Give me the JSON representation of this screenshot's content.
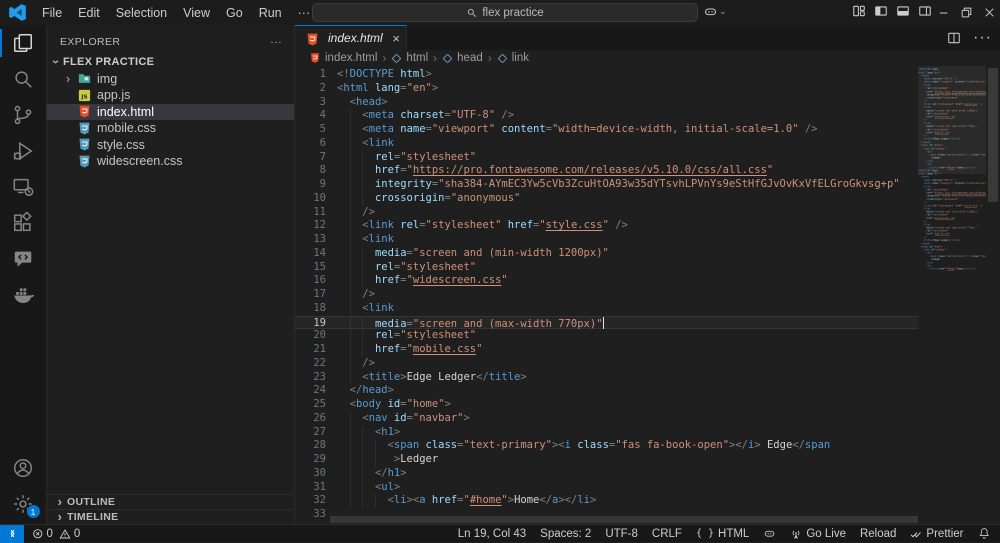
{
  "colors": {
    "accent": "#0078d4",
    "html_icon": "#e44d26",
    "css_icon": "#519aba",
    "js_icon": "#cbcb41",
    "folder_icon": "#45a795",
    "logo": "#1f9cf0",
    "symbol_icon": "#75a3c9"
  },
  "titlebar": {
    "menus": [
      "File",
      "Edit",
      "Selection",
      "View",
      "Go",
      "Run"
    ],
    "more_label": "···",
    "search_value": "flex practice"
  },
  "activitybar": {
    "items": [
      {
        "name": "explorer-icon",
        "active": true
      },
      {
        "name": "search-icon",
        "active": false
      },
      {
        "name": "source-control-icon",
        "active": false
      },
      {
        "name": "run-debug-icon",
        "active": false
      },
      {
        "name": "remote-explorer-icon",
        "active": false
      },
      {
        "name": "extensions-icon",
        "active": false
      },
      {
        "name": "chat-icon",
        "active": false
      },
      {
        "name": "docker-icon",
        "active": false
      }
    ],
    "bottom": [
      {
        "name": "account-icon"
      },
      {
        "name": "settings-gear-icon",
        "badge": "1"
      }
    ]
  },
  "sidebar": {
    "header": "EXPLORER",
    "root": "FLEX PRACTICE",
    "files": [
      {
        "label": "img",
        "type": "folder",
        "chevron": true
      },
      {
        "label": "app.js",
        "type": "js"
      },
      {
        "label": "index.html",
        "type": "html",
        "selected": true
      },
      {
        "label": "mobile.css",
        "type": "css"
      },
      {
        "label": "style.css",
        "type": "css"
      },
      {
        "label": "widescreen.css",
        "type": "css"
      }
    ],
    "sections": [
      "OUTLINE",
      "TIMELINE"
    ]
  },
  "editor": {
    "tab": {
      "label": "index.html",
      "close": "×"
    },
    "breadcrumbs": [
      {
        "label": "index.html",
        "icon": "html"
      },
      {
        "label": "html",
        "icon": "symbol"
      },
      {
        "label": "head",
        "icon": "symbol"
      },
      {
        "label": "link",
        "icon": "symbol"
      }
    ],
    "lines": [
      {
        "n": 1,
        "ind": 0,
        "tok": [
          [
            "p",
            "<!"
          ],
          [
            "t",
            "DOCTYPE"
          ],
          [
            "a",
            " html"
          ],
          [
            "p",
            ">"
          ]
        ]
      },
      {
        "n": 2,
        "ind": 0,
        "tok": [
          [
            "p",
            "<"
          ],
          [
            "t",
            "html"
          ],
          [
            "a",
            " lang"
          ],
          [
            "p",
            "="
          ],
          [
            "s",
            "\"en\""
          ],
          [
            "p",
            ">"
          ]
        ]
      },
      {
        "n": 3,
        "ind": 2,
        "tok": [
          [
            "p",
            "<"
          ],
          [
            "t",
            "head"
          ],
          [
            "p",
            ">"
          ]
        ]
      },
      {
        "n": 4,
        "ind": 4,
        "tok": [
          [
            "p",
            "<"
          ],
          [
            "t",
            "meta"
          ],
          [
            "a",
            " charset"
          ],
          [
            "p",
            "="
          ],
          [
            "s",
            "\"UTF-8\""
          ],
          [
            "p",
            " />"
          ]
        ]
      },
      {
        "n": 5,
        "ind": 4,
        "tok": [
          [
            "p",
            "<"
          ],
          [
            "t",
            "meta"
          ],
          [
            "a",
            " name"
          ],
          [
            "p",
            "="
          ],
          [
            "s",
            "\"viewport\""
          ],
          [
            "a",
            " content"
          ],
          [
            "p",
            "="
          ],
          [
            "s",
            "\"width=device-width, initial-scale=1.0\""
          ],
          [
            "p",
            " />"
          ]
        ]
      },
      {
        "n": 6,
        "ind": 4,
        "tok": [
          [
            "p",
            "<"
          ],
          [
            "t",
            "link"
          ]
        ]
      },
      {
        "n": 7,
        "ind": 6,
        "tok": [
          [
            "a",
            "rel"
          ],
          [
            "p",
            "="
          ],
          [
            "s",
            "\"stylesheet\""
          ]
        ]
      },
      {
        "n": 8,
        "ind": 6,
        "tok": [
          [
            "a",
            "href"
          ],
          [
            "p",
            "="
          ],
          [
            "s",
            "\""
          ],
          [
            "u",
            "https://pro.fontawesome.com/releases/v5.10.0/css/all.css"
          ],
          [
            "s",
            "\""
          ]
        ]
      },
      {
        "n": 9,
        "ind": 6,
        "tok": [
          [
            "a",
            "integrity"
          ],
          [
            "p",
            "="
          ],
          [
            "s",
            "\"sha384-AYmEC3Yw5cVb3ZcuHtOA93w35dYTsvhLPVnYs9eStHfGJvOvKxVfELGroGkvsg+p\""
          ]
        ]
      },
      {
        "n": 10,
        "ind": 6,
        "tok": [
          [
            "a",
            "crossorigin"
          ],
          [
            "p",
            "="
          ],
          [
            "s",
            "\"anonymous\""
          ]
        ]
      },
      {
        "n": 11,
        "ind": 4,
        "tok": [
          [
            "p",
            "/>"
          ]
        ]
      },
      {
        "n": 12,
        "ind": 4,
        "tok": [
          [
            "p",
            "<"
          ],
          [
            "t",
            "link"
          ],
          [
            "a",
            " rel"
          ],
          [
            "p",
            "="
          ],
          [
            "s",
            "\"stylesheet\""
          ],
          [
            "a",
            " href"
          ],
          [
            "p",
            "="
          ],
          [
            "s",
            "\""
          ],
          [
            "u",
            "style.css"
          ],
          [
            "s",
            "\""
          ],
          [
            "p",
            " />"
          ]
        ]
      },
      {
        "n": 13,
        "ind": 4,
        "tok": [
          [
            "p",
            "<"
          ],
          [
            "t",
            "link"
          ]
        ]
      },
      {
        "n": 14,
        "ind": 6,
        "tok": [
          [
            "a",
            "media"
          ],
          [
            "p",
            "="
          ],
          [
            "s",
            "\"screen and (min-width 1200px)\""
          ]
        ]
      },
      {
        "n": 15,
        "ind": 6,
        "tok": [
          [
            "a",
            "rel"
          ],
          [
            "p",
            "="
          ],
          [
            "s",
            "\"stylesheet\""
          ]
        ]
      },
      {
        "n": 16,
        "ind": 6,
        "tok": [
          [
            "a",
            "href"
          ],
          [
            "p",
            "="
          ],
          [
            "s",
            "\""
          ],
          [
            "u",
            "widescreen.css"
          ],
          [
            "s",
            "\""
          ]
        ]
      },
      {
        "n": 17,
        "ind": 4,
        "tok": [
          [
            "p",
            "/>"
          ]
        ]
      },
      {
        "n": 18,
        "ind": 4,
        "tok": [
          [
            "p",
            "<"
          ],
          [
            "t",
            "link"
          ]
        ]
      },
      {
        "n": 19,
        "ind": 6,
        "cur": true,
        "tok": [
          [
            "a",
            "media"
          ],
          [
            "p",
            "="
          ],
          [
            "s",
            "\"screen and (max-width 770px)\""
          ]
        ]
      },
      {
        "n": 20,
        "ind": 6,
        "tok": [
          [
            "a",
            "rel"
          ],
          [
            "p",
            "="
          ],
          [
            "s",
            "\"stylesheet\""
          ]
        ]
      },
      {
        "n": 21,
        "ind": 6,
        "tok": [
          [
            "a",
            "href"
          ],
          [
            "p",
            "="
          ],
          [
            "s",
            "\""
          ],
          [
            "u",
            "mobile.css"
          ],
          [
            "s",
            "\""
          ]
        ]
      },
      {
        "n": 22,
        "ind": 4,
        "tok": [
          [
            "p",
            "/>"
          ]
        ]
      },
      {
        "n": 23,
        "ind": 4,
        "tok": [
          [
            "p",
            "<"
          ],
          [
            "t",
            "title"
          ],
          [
            "p",
            ">"
          ],
          [
            "x",
            "Edge Ledger"
          ],
          [
            "p",
            "</"
          ],
          [
            "t",
            "title"
          ],
          [
            "p",
            ">"
          ]
        ]
      },
      {
        "n": 24,
        "ind": 2,
        "tok": [
          [
            "p",
            "</"
          ],
          [
            "t",
            "head"
          ],
          [
            "p",
            ">"
          ]
        ]
      },
      {
        "n": 25,
        "ind": 2,
        "tok": [
          [
            "p",
            "<"
          ],
          [
            "t",
            "body"
          ],
          [
            "a",
            " id"
          ],
          [
            "p",
            "="
          ],
          [
            "s",
            "\"home\""
          ],
          [
            "p",
            ">"
          ]
        ]
      },
      {
        "n": 26,
        "ind": 4,
        "tok": [
          [
            "p",
            "<"
          ],
          [
            "t",
            "nav"
          ],
          [
            "a",
            " id"
          ],
          [
            "p",
            "="
          ],
          [
            "s",
            "\"navbar\""
          ],
          [
            "p",
            ">"
          ]
        ]
      },
      {
        "n": 27,
        "ind": 6,
        "tok": [
          [
            "p",
            "<"
          ],
          [
            "t",
            "h1"
          ],
          [
            "p",
            ">"
          ]
        ]
      },
      {
        "n": 28,
        "ind": 8,
        "tok": [
          [
            "p",
            "<"
          ],
          [
            "t",
            "span"
          ],
          [
            "a",
            " class"
          ],
          [
            "p",
            "="
          ],
          [
            "s",
            "\"text-primary\""
          ],
          [
            "p",
            "><"
          ],
          [
            "t",
            "i"
          ],
          [
            "a",
            " class"
          ],
          [
            "p",
            "="
          ],
          [
            "s",
            "\"fas fa-book-open\""
          ],
          [
            "p",
            "></"
          ],
          [
            "t",
            "i"
          ],
          [
            "p",
            ">"
          ],
          [
            "x",
            " Edge"
          ],
          [
            "p",
            "</"
          ],
          [
            "t",
            "span"
          ]
        ]
      },
      {
        "n": 29,
        "ind": 9,
        "tok": [
          [
            "p",
            ">"
          ],
          [
            "x",
            "Ledger"
          ]
        ]
      },
      {
        "n": 30,
        "ind": 6,
        "tok": [
          [
            "p",
            "</"
          ],
          [
            "t",
            "h1"
          ],
          [
            "p",
            ">"
          ]
        ]
      },
      {
        "n": 31,
        "ind": 6,
        "tok": [
          [
            "p",
            "<"
          ],
          [
            "t",
            "ul"
          ],
          [
            "p",
            ">"
          ]
        ]
      },
      {
        "n": 32,
        "ind": 8,
        "tok": [
          [
            "p",
            "<"
          ],
          [
            "t",
            "li"
          ],
          [
            "p",
            "><"
          ],
          [
            "t",
            "a"
          ],
          [
            "a",
            " href"
          ],
          [
            "p",
            "="
          ],
          [
            "s",
            "\""
          ],
          [
            "u",
            "#home"
          ],
          [
            "s",
            "\""
          ],
          [
            "p",
            ">"
          ],
          [
            "x",
            "Home"
          ],
          [
            "p",
            "</"
          ],
          [
            "t",
            "a"
          ],
          [
            "p",
            "></"
          ],
          [
            "t",
            "li"
          ],
          [
            "p",
            ">"
          ]
        ]
      },
      {
        "n": 33,
        "ind": 0,
        "tok": []
      }
    ]
  },
  "statusbar": {
    "errors": "0",
    "warnings": "0",
    "right": [
      {
        "name": "cursor-position",
        "label": "Ln 19, Col 43"
      },
      {
        "name": "indentation",
        "label": "Spaces: 2"
      },
      {
        "name": "encoding",
        "label": "UTF-8"
      },
      {
        "name": "eol",
        "label": "CRLF"
      },
      {
        "name": "language-mode",
        "label": "HTML",
        "icon": "braces"
      },
      {
        "name": "copilot-status",
        "label": "",
        "icon": "copilot"
      },
      {
        "name": "go-live",
        "label": "Go Live",
        "icon": "broadcast"
      },
      {
        "name": "reload",
        "label": "Reload"
      },
      {
        "name": "prettier",
        "label": "Prettier",
        "icon": "double-check"
      },
      {
        "name": "notifications",
        "label": "",
        "icon": "bell"
      }
    ]
  }
}
